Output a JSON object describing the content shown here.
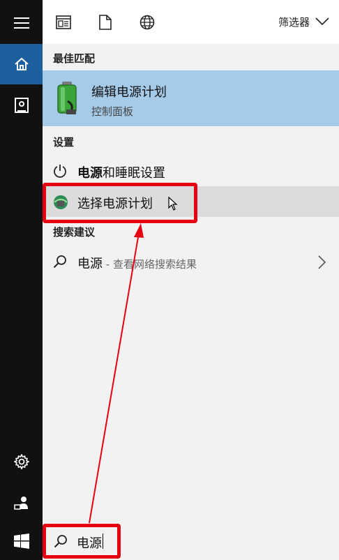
{
  "rail": {
    "items": [
      {
        "name": "hamburger-icon"
      },
      {
        "name": "home-icon",
        "active": true
      },
      {
        "name": "documents-icon"
      },
      {
        "name": "settings-icon"
      },
      {
        "name": "user-icon"
      },
      {
        "name": "windows-start-icon"
      }
    ]
  },
  "topbar": {
    "icons": [
      "apps-icon",
      "document-icon",
      "web-icon"
    ],
    "filter_label": "筛选器"
  },
  "sections": {
    "best_match": "最佳匹配",
    "settings": "设置",
    "suggestions": "搜索建议"
  },
  "best_match": {
    "title": "编辑电源计划",
    "subtitle": "控制面板",
    "icon": "battery-plug-icon"
  },
  "settings_items": {
    "power_sleep_bold": "电源",
    "power_sleep_rest": "和睡眠设置",
    "choose_plan": "选择电源计划"
  },
  "suggestion": {
    "query": "电源",
    "hint": " - 查看网络搜索结果"
  },
  "search": {
    "value": "电源"
  },
  "colors": {
    "accent": "#1e5f9e",
    "best_match_bg": "#a6cbe9",
    "highlight_bg": "#dcdcdc",
    "annotation_red": "#e60012"
  }
}
